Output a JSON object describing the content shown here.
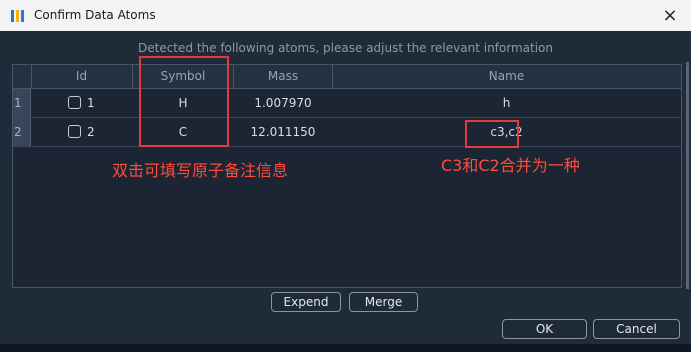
{
  "window": {
    "title": "Confirm Data Atoms",
    "close_icon": "×"
  },
  "subtitle": "Detected the following atoms, please adjust the relevant information",
  "table": {
    "columns": [
      "Id",
      "Symbol",
      "Mass",
      "Name"
    ],
    "rows": [
      {
        "rownum": "1",
        "id": "1",
        "symbol": "H",
        "mass": "1.007970",
        "name": "h"
      },
      {
        "rownum": "2",
        "id": "2",
        "symbol": "C",
        "mass": "12.011150",
        "name": "c3,c2"
      }
    ]
  },
  "annotations": {
    "note1": "双击可填写原子备注信息",
    "note2": "C3和C2合并为一种"
  },
  "buttons": {
    "expend": "Expend",
    "merge": "Merge",
    "ok": "OK",
    "cancel": "Cancel"
  },
  "colors": {
    "annotation_red": "#e23b3b",
    "background": "#202b3a"
  }
}
